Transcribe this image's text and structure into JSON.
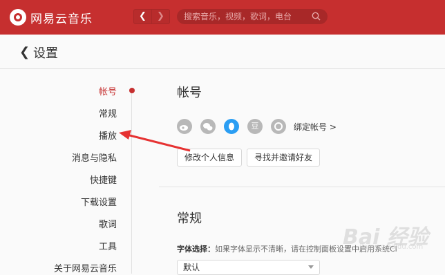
{
  "app": {
    "name": "网易云音乐"
  },
  "search": {
    "placeholder": "搜索音乐，视频，歌词，电台"
  },
  "header": {
    "title": "设置"
  },
  "sidebar": {
    "items": [
      {
        "label": "帐号",
        "active": true
      },
      {
        "label": "常规"
      },
      {
        "label": "播放"
      },
      {
        "label": "消息与隐私"
      },
      {
        "label": "快捷键"
      },
      {
        "label": "下载设置"
      },
      {
        "label": "歌词"
      },
      {
        "label": "工具"
      },
      {
        "label": "关于网易云音乐"
      }
    ]
  },
  "account": {
    "title": "帐号",
    "bind_label": "绑定帐号",
    "bind_chevron": ">",
    "edit_profile_label": "修改个人信息",
    "invite_friends_label": "寻找并邀请好友",
    "icons": [
      "weibo-icon",
      "wechat-icon",
      "qq-icon",
      "douban-icon",
      "netease-icon"
    ],
    "douban_glyph": "豆"
  },
  "general": {
    "title": "常规",
    "font_label": "字体选择：",
    "font_hint": "如果字体显示不清晰，请在控制面板",
    "font_hint_tail": "设置中启用系统Cl",
    "font_value": "默认"
  },
  "watermark": {
    "text": "Bai 经验",
    "sub": "jingyan.baidu.com"
  },
  "colors": {
    "brand": "#c62f2f",
    "qq": "#2b9ef3"
  }
}
